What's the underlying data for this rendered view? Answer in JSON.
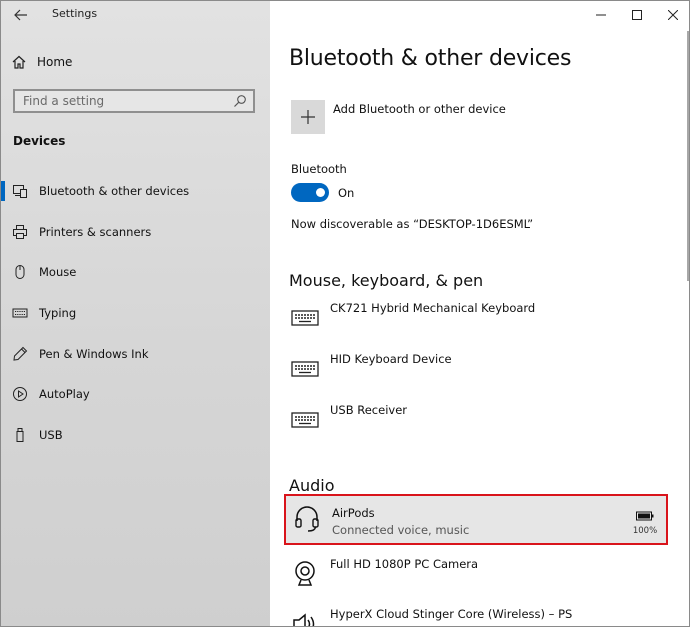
{
  "window": {
    "title": "Settings"
  },
  "sidebar": {
    "home_label": "Home",
    "search_placeholder": "Find a setting",
    "section_label": "Devices",
    "items": [
      {
        "label": "Bluetooth & other devices",
        "icon": "bluetooth-devices-icon",
        "selected": true
      },
      {
        "label": "Printers & scanners",
        "icon": "printer-icon",
        "selected": false
      },
      {
        "label": "Mouse",
        "icon": "mouse-icon",
        "selected": false
      },
      {
        "label": "Typing",
        "icon": "keyboard-icon",
        "selected": false
      },
      {
        "label": "Pen & Windows Ink",
        "icon": "pen-icon",
        "selected": false
      },
      {
        "label": "AutoPlay",
        "icon": "autoplay-icon",
        "selected": false
      },
      {
        "label": "USB",
        "icon": "usb-icon",
        "selected": false
      }
    ]
  },
  "main": {
    "page_title": "Bluetooth & other devices",
    "add_device_label": "Add Bluetooth or other device",
    "bluetooth": {
      "label": "Bluetooth",
      "state_label": "On",
      "on": true,
      "discoverable_text": "Now discoverable as “DESKTOP-1D6ESML”"
    },
    "mouse_keyboard_pen": {
      "heading": "Mouse, keyboard, & pen",
      "devices": [
        {
          "name": "CK721 Hybrid Mechanical Keyboard",
          "icon": "keyboard-icon"
        },
        {
          "name": "HID Keyboard Device",
          "icon": "keyboard-icon"
        },
        {
          "name": "USB Receiver",
          "icon": "keyboard-icon"
        }
      ]
    },
    "audio": {
      "heading": "Audio",
      "devices": [
        {
          "name": "AirPods",
          "status": "Connected voice, music",
          "icon": "headset-icon",
          "battery": "100%"
        },
        {
          "name": "Full HD 1080P PC Camera",
          "icon": "webcam-icon"
        },
        {
          "name": "HyperX Cloud Stinger Core (Wireless) – PS",
          "icon": "speaker-icon"
        }
      ]
    }
  },
  "colors": {
    "accent": "#0067c0",
    "highlight_border": "#d9141b"
  }
}
